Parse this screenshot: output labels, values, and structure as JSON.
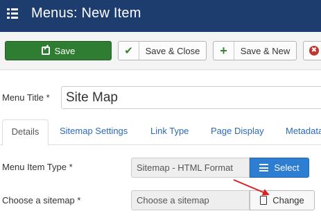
{
  "header": {
    "title": "Menus: New Item",
    "icon": "list-icon",
    "bg_color": "#1c3d6e"
  },
  "toolbar": {
    "save_label": "Save",
    "save_close_label": "Save & Close",
    "save_new_label": "Save & New",
    "save_color": "#2f7d32"
  },
  "form": {
    "menu_title_label": "Menu Title *",
    "menu_title_value": "Site Map"
  },
  "tabs": [
    {
      "label": "Details",
      "active": true
    },
    {
      "label": "Sitemap Settings"
    },
    {
      "label": "Link Type"
    },
    {
      "label": "Page Display"
    },
    {
      "label": "Metadata"
    }
  ],
  "fields": {
    "menu_item_type_label": "Menu Item Type *",
    "menu_item_type_value": "Sitemap - HTML Format",
    "select_label": "Select",
    "choose_sitemap_label": "Choose a sitemap *",
    "choose_sitemap_value": "Choose a sitemap",
    "change_label": "Change"
  },
  "annotation": {
    "arrow_color": "#e02020"
  }
}
